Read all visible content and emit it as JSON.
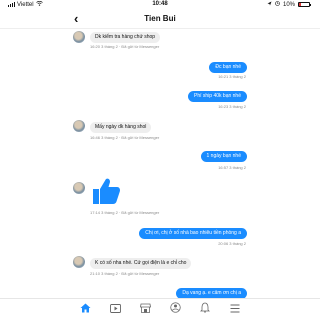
{
  "status_bar": {
    "carrier": "Viettel",
    "time": "10:48",
    "battery": "10%"
  },
  "header": {
    "title": "Tien Bui"
  },
  "messages": [
    {
      "text": "Dk kiểm tra hàng chứ shop",
      "meta": "16:20 3 tháng 2 · Đã gửi từ Messenger"
    },
    {
      "text": "Đc bạn nhé",
      "meta": "16:21 3 tháng 2"
    },
    {
      "text": "Phí ship 40k bạn nhé",
      "meta": "16:23 3 tháng 2"
    },
    {
      "text": "Mấy ngày dk hàng shol",
      "meta": "16:46 3 tháng 2 · Đã gửi từ Messenger"
    },
    {
      "text": "1 ngày bạn nhé",
      "meta": "16:57 3 tháng 2"
    },
    {
      "meta": "17:14 3 tháng 2 · Đã gửi từ Messenger"
    },
    {
      "text": "Chị ơi, chị ở số nhà bao nhiêu tiền phòng a",
      "meta": "20:06 3 tháng 2"
    },
    {
      "text": "K có số nha nhé. Cứ gọi điện là e chỉ cho",
      "meta": "21:10 3 tháng 2 · Đã gửi từ Messenger"
    },
    {
      "text": "Dạ vang ạ. e cảm ơn chị a"
    }
  ],
  "colors": {
    "accent": "#1a8cff",
    "incoming_bubble": "#eeeeee",
    "meta_text": "#8a8a8a"
  },
  "icons": {
    "back": "chevron-left-icon",
    "like": "thumbs-up-icon",
    "tabs": [
      "home-icon",
      "video-icon",
      "store-icon",
      "groups-icon",
      "bell-icon",
      "menu-icon"
    ]
  }
}
